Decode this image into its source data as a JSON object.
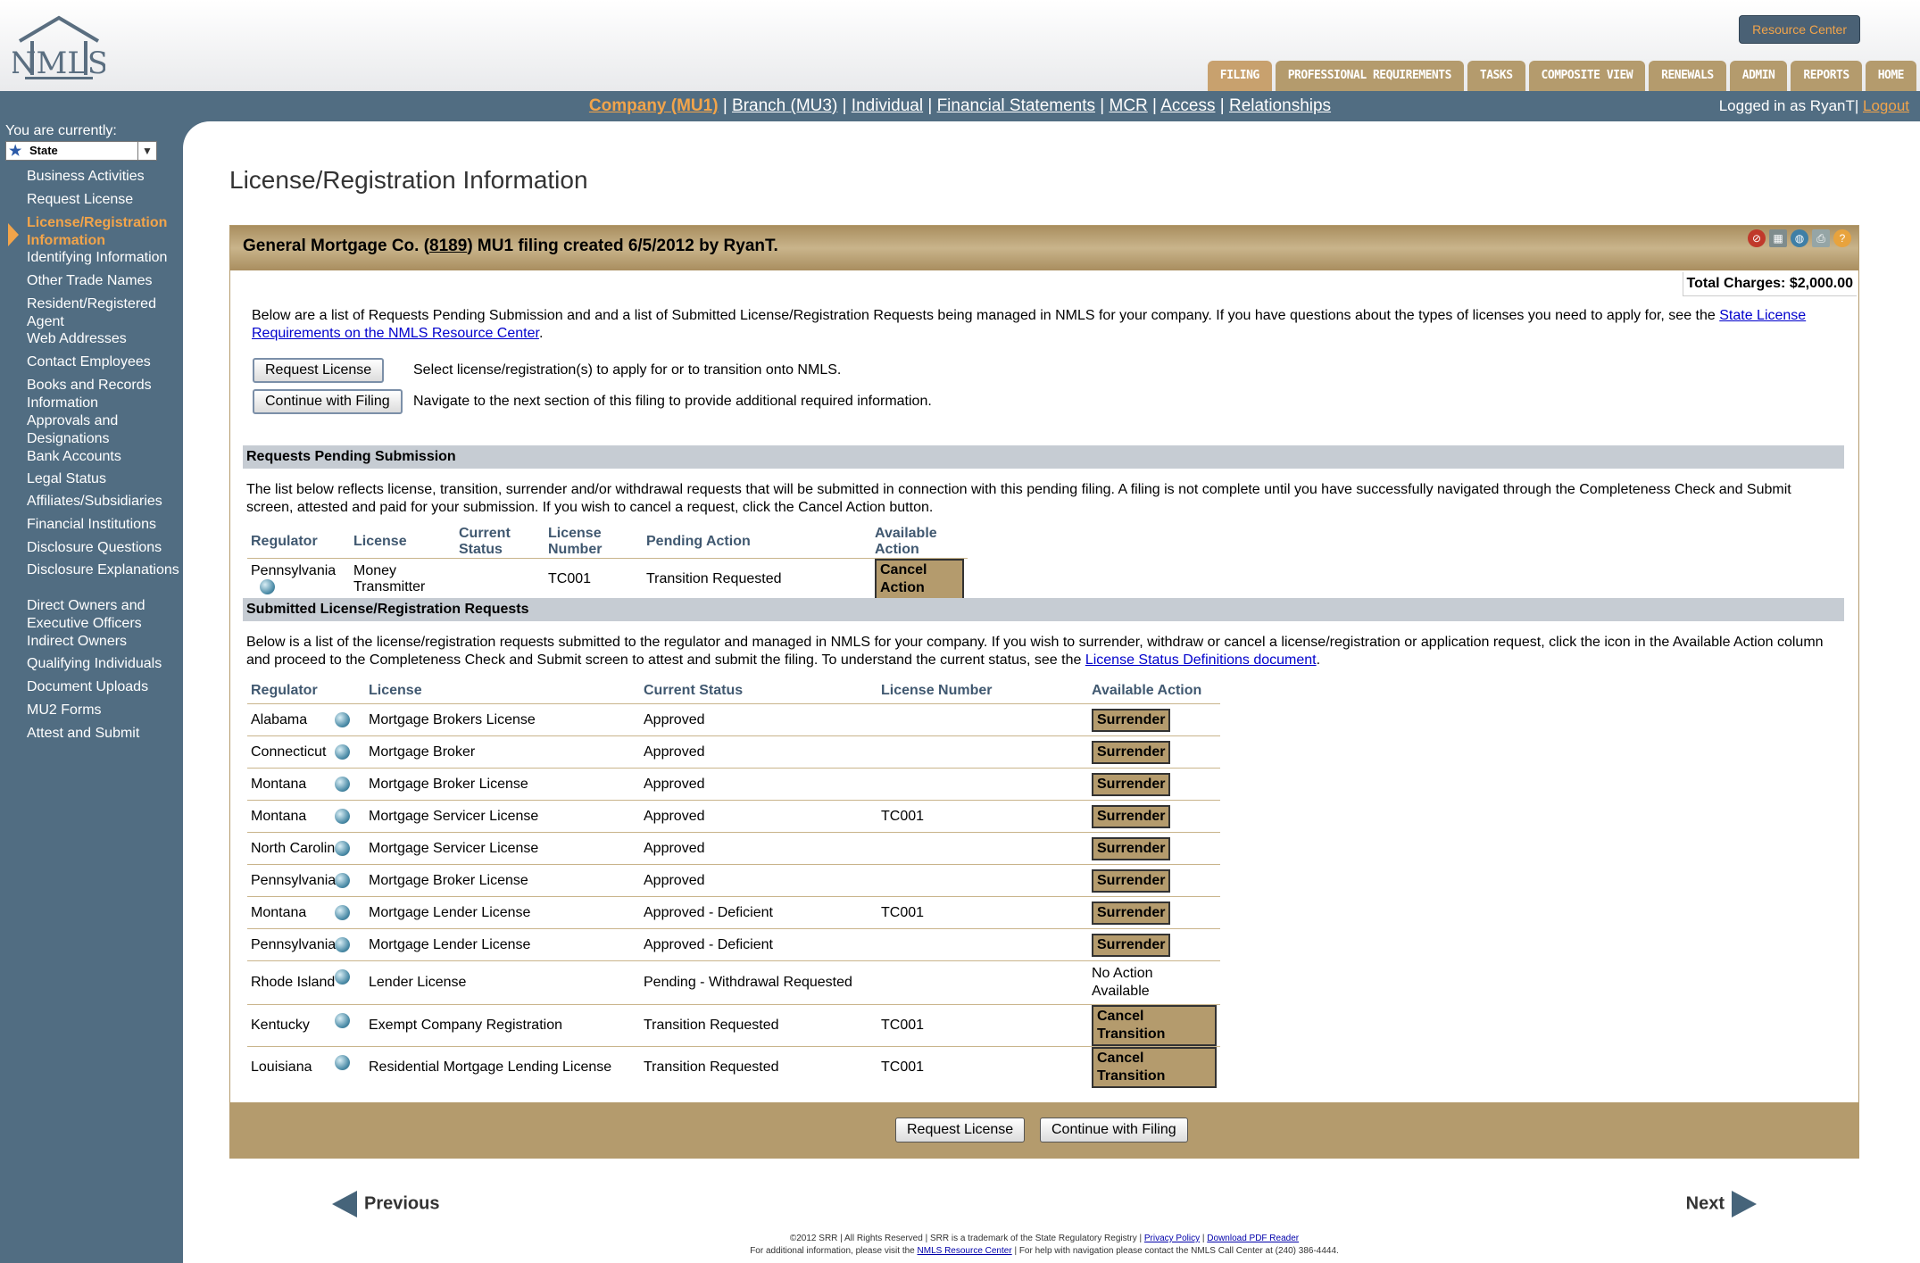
{
  "header": {
    "logo_text": "NMLS",
    "resource_center": "Resource Center",
    "tabs": [
      "FILING",
      "PROFESSIONAL REQUIREMENTS",
      "TASKS",
      "COMPOSITE VIEW",
      "RENEWALS",
      "ADMIN",
      "REPORTS",
      "HOME"
    ]
  },
  "subnav": {
    "links": [
      "Company (MU1)",
      "Branch (MU3)",
      "Individual",
      "Financial Statements",
      "MCR",
      "Access",
      "Relationships"
    ],
    "separator": " | ",
    "logged_in": "Logged in as RyanT",
    "logout": "Logout"
  },
  "sidebar": {
    "currently_label": "You are currently:",
    "state_value": "State",
    "items": [
      "Business Activities",
      "Request License",
      "License/Registration Information",
      "Identifying Information",
      "Other Trade Names",
      "Resident/Registered Agent",
      "Web Addresses",
      "Contact Employees",
      "Books and Records Information",
      "Approvals and Designations",
      "Bank Accounts",
      "Legal Status",
      "Affiliates/Subsidiaries",
      "Financial Institutions",
      "Disclosure Questions",
      "Disclosure Explanations",
      "Direct Owners and Executive Officers",
      "Indirect Owners",
      "Qualifying Individuals",
      "Document Uploads",
      "MU2 Forms",
      "Attest and Submit"
    ]
  },
  "page": {
    "title": "License/Registration Information"
  },
  "panel": {
    "title_pre": "General Mortgage Co. (",
    "title_id": "8189",
    "title_post": ") MU1 filing created 6/5/2012 by RyanT.",
    "total_charges": "Total Charges: $2,000.00",
    "intro_text": "Below are a list of Requests Pending Submission and and a list of Submitted License/Registration Requests being managed in NMLS for your company. If you have questions about the types of licenses you need to apply for, see the ",
    "intro_link": "State License Requirements on the NMLS Resource Center",
    "request_btn": "Request License",
    "request_desc": "Select license/registration(s) to apply for or to transition onto NMLS.",
    "continue_btn": "Continue with Filing",
    "continue_desc": "Navigate to the next section of this filing to provide additional required information."
  },
  "pending": {
    "heading": "Requests Pending Submission",
    "desc": "The list below reflects license, transition, surrender and/or withdrawal requests that will be submitted in connection with this pending filing. A filing is not complete until you have successfully navigated through the Completeness Check and Submit screen, attested and paid for your submission. If you wish to cancel a request, click the Cancel Action button.",
    "columns": [
      "Regulator",
      "License",
      "Current Status",
      "License Number",
      "Pending Action",
      "Available Action"
    ],
    "rows": [
      {
        "regulator": "Pennsylvania",
        "license": "Money Transmitter",
        "status": "",
        "number": "TC001",
        "pending": "Transition Requested",
        "action": "Cancel Action"
      }
    ]
  },
  "submitted": {
    "heading": "Submitted License/Registration Requests",
    "desc": "Below is a list of the license/registration requests submitted to the regulator and managed in NMLS for your company. If you wish to surrender, withdraw or cancel a license/registration or application request, click the icon in the Available Action column and proceed to the Completeness Check and Submit screen to attest and submit the filing. To understand the current status, see the ",
    "desc_link": "License Status Definitions document",
    "columns": [
      "Regulator",
      "License",
      "Current Status",
      "License Number",
      "Available Action"
    ],
    "rows": [
      {
        "regulator": "Alabama",
        "license": "Mortgage Brokers License",
        "status": "Approved",
        "number": "",
        "action": "Surrender"
      },
      {
        "regulator": "Connecticut",
        "license": "Mortgage Broker",
        "status": "Approved",
        "number": "",
        "action": "Surrender"
      },
      {
        "regulator": "Montana",
        "license": "Mortgage Broker License",
        "status": "Approved",
        "number": "",
        "action": "Surrender"
      },
      {
        "regulator": "Montana",
        "license": "Mortgage Servicer License",
        "status": "Approved",
        "number": "TC001",
        "action": "Surrender"
      },
      {
        "regulator": "North Carolina",
        "license": "Mortgage Servicer License",
        "status": "Approved",
        "number": "",
        "action": "Surrender"
      },
      {
        "regulator": "Pennsylvania",
        "license": "Mortgage Broker License",
        "status": "Approved",
        "number": "",
        "action": "Surrender"
      },
      {
        "regulator": "Montana",
        "license": "Mortgage Lender License",
        "status": "Approved - Deficient",
        "number": "TC001",
        "action": "Surrender"
      },
      {
        "regulator": "Pennsylvania",
        "license": "Mortgage Lender License",
        "status": "Approved - Deficient",
        "number": "",
        "action": "Surrender"
      },
      {
        "regulator": "Rhode Island",
        "license": "Lender License",
        "status": "Pending - Withdrawal Requested",
        "number": "",
        "action_text": "No Action Available"
      },
      {
        "regulator": "Kentucky",
        "license": "Exempt Company Registration",
        "status": "Transition Requested",
        "number": "TC001",
        "action": "Cancel Transition"
      },
      {
        "regulator": "Louisiana",
        "license": "Residential Mortgage Lending License",
        "status": "Transition Requested",
        "number": "TC001",
        "action": "Cancel Transition"
      }
    ]
  },
  "footer_buttons": {
    "request": "Request License",
    "continue": "Continue with Filing"
  },
  "pager": {
    "previous": "Previous",
    "next": "Next"
  },
  "footer": {
    "line1": "©2012 SRR | All Rights Reserved | SRR is a trademark of the State Regulatory Registry | ",
    "privacy": "Privacy Policy",
    "sep": " | ",
    "pdf": "Download PDF Reader",
    "line2a": "For additional information, please visit the ",
    "resource": "NMLS Resource Center",
    "line2b": " | For help with navigation please contact the NMLS Call Center at (240) 386-4444."
  },
  "colors": {
    "nav_bg": "#516d82",
    "accent_orange": "#f2a44a",
    "tan": "#b49b6d"
  }
}
